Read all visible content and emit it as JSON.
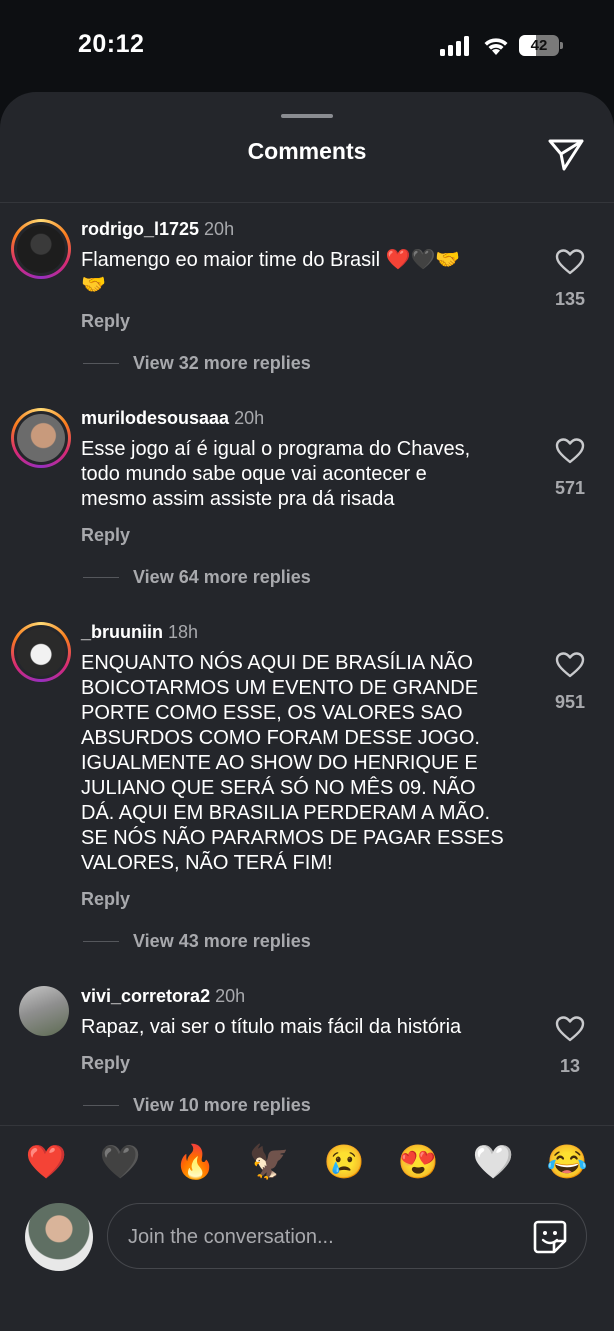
{
  "status": {
    "time": "20:12",
    "battery": "42",
    "battery_level": 0.42
  },
  "sheet": {
    "title": "Comments"
  },
  "comments": [
    {
      "username": "rodrigo_l1725",
      "time": "20h",
      "text": "Flamengo eo maior time do Brasil ❤️🖤🤝\n🤝",
      "reply": "Reply",
      "view_more": "View 32 more replies",
      "likes": "135"
    },
    {
      "username": "murilodesousaaa",
      "time": "20h",
      "text": "Esse jogo aí é igual o programa do Chaves,\ntodo mundo sabe oque vai acontecer e\nmesmo assim assiste pra dá risada",
      "reply": "Reply",
      "view_more": "View 64 more replies",
      "likes": "571"
    },
    {
      "username": "_bruuniin",
      "time": "18h",
      "text": "ENQUANTO NÓS AQUI DE BRASÍLIA NÃO\nBOICOTARMOS UM EVENTO DE GRANDE\nPORTE COMO ESSE, OS VALORES SAO\nABSURDOS COMO FORAM DESSE JOGO.\nIGUALMENTE AO SHOW DO HENRIQUE E\nJULIANO QUE SERÁ SÓ NO MÊS 09. NÃO\nDÁ. AQUI EM BRASILIA PERDERAM A MÃO.\nSE NÓS NÃO PARARMOS DE PAGAR ESSES\nVALORES, NÃO TERÁ FIM!",
      "reply": "Reply",
      "view_more": "View 43 more replies",
      "likes": "951"
    },
    {
      "username": "vivi_corretora2",
      "time": "20h",
      "text": "Rapaz, vai ser o título mais fácil da história",
      "reply": "Reply",
      "view_more": "View 10 more replies",
      "likes": "13"
    }
  ],
  "reactions": [
    "❤️",
    "🖤",
    "🔥",
    "🦅",
    "😢",
    "😍",
    "🤍",
    "😂"
  ],
  "composer": {
    "placeholder": "Join the conversation..."
  },
  "icons": {
    "share": "paper-plane-icon",
    "like": "heart-outline-icon",
    "sticker": "sticker-face-icon"
  },
  "colors": {
    "sheet_bg": "#24262b",
    "text_secondary": "#a8a9ad"
  }
}
